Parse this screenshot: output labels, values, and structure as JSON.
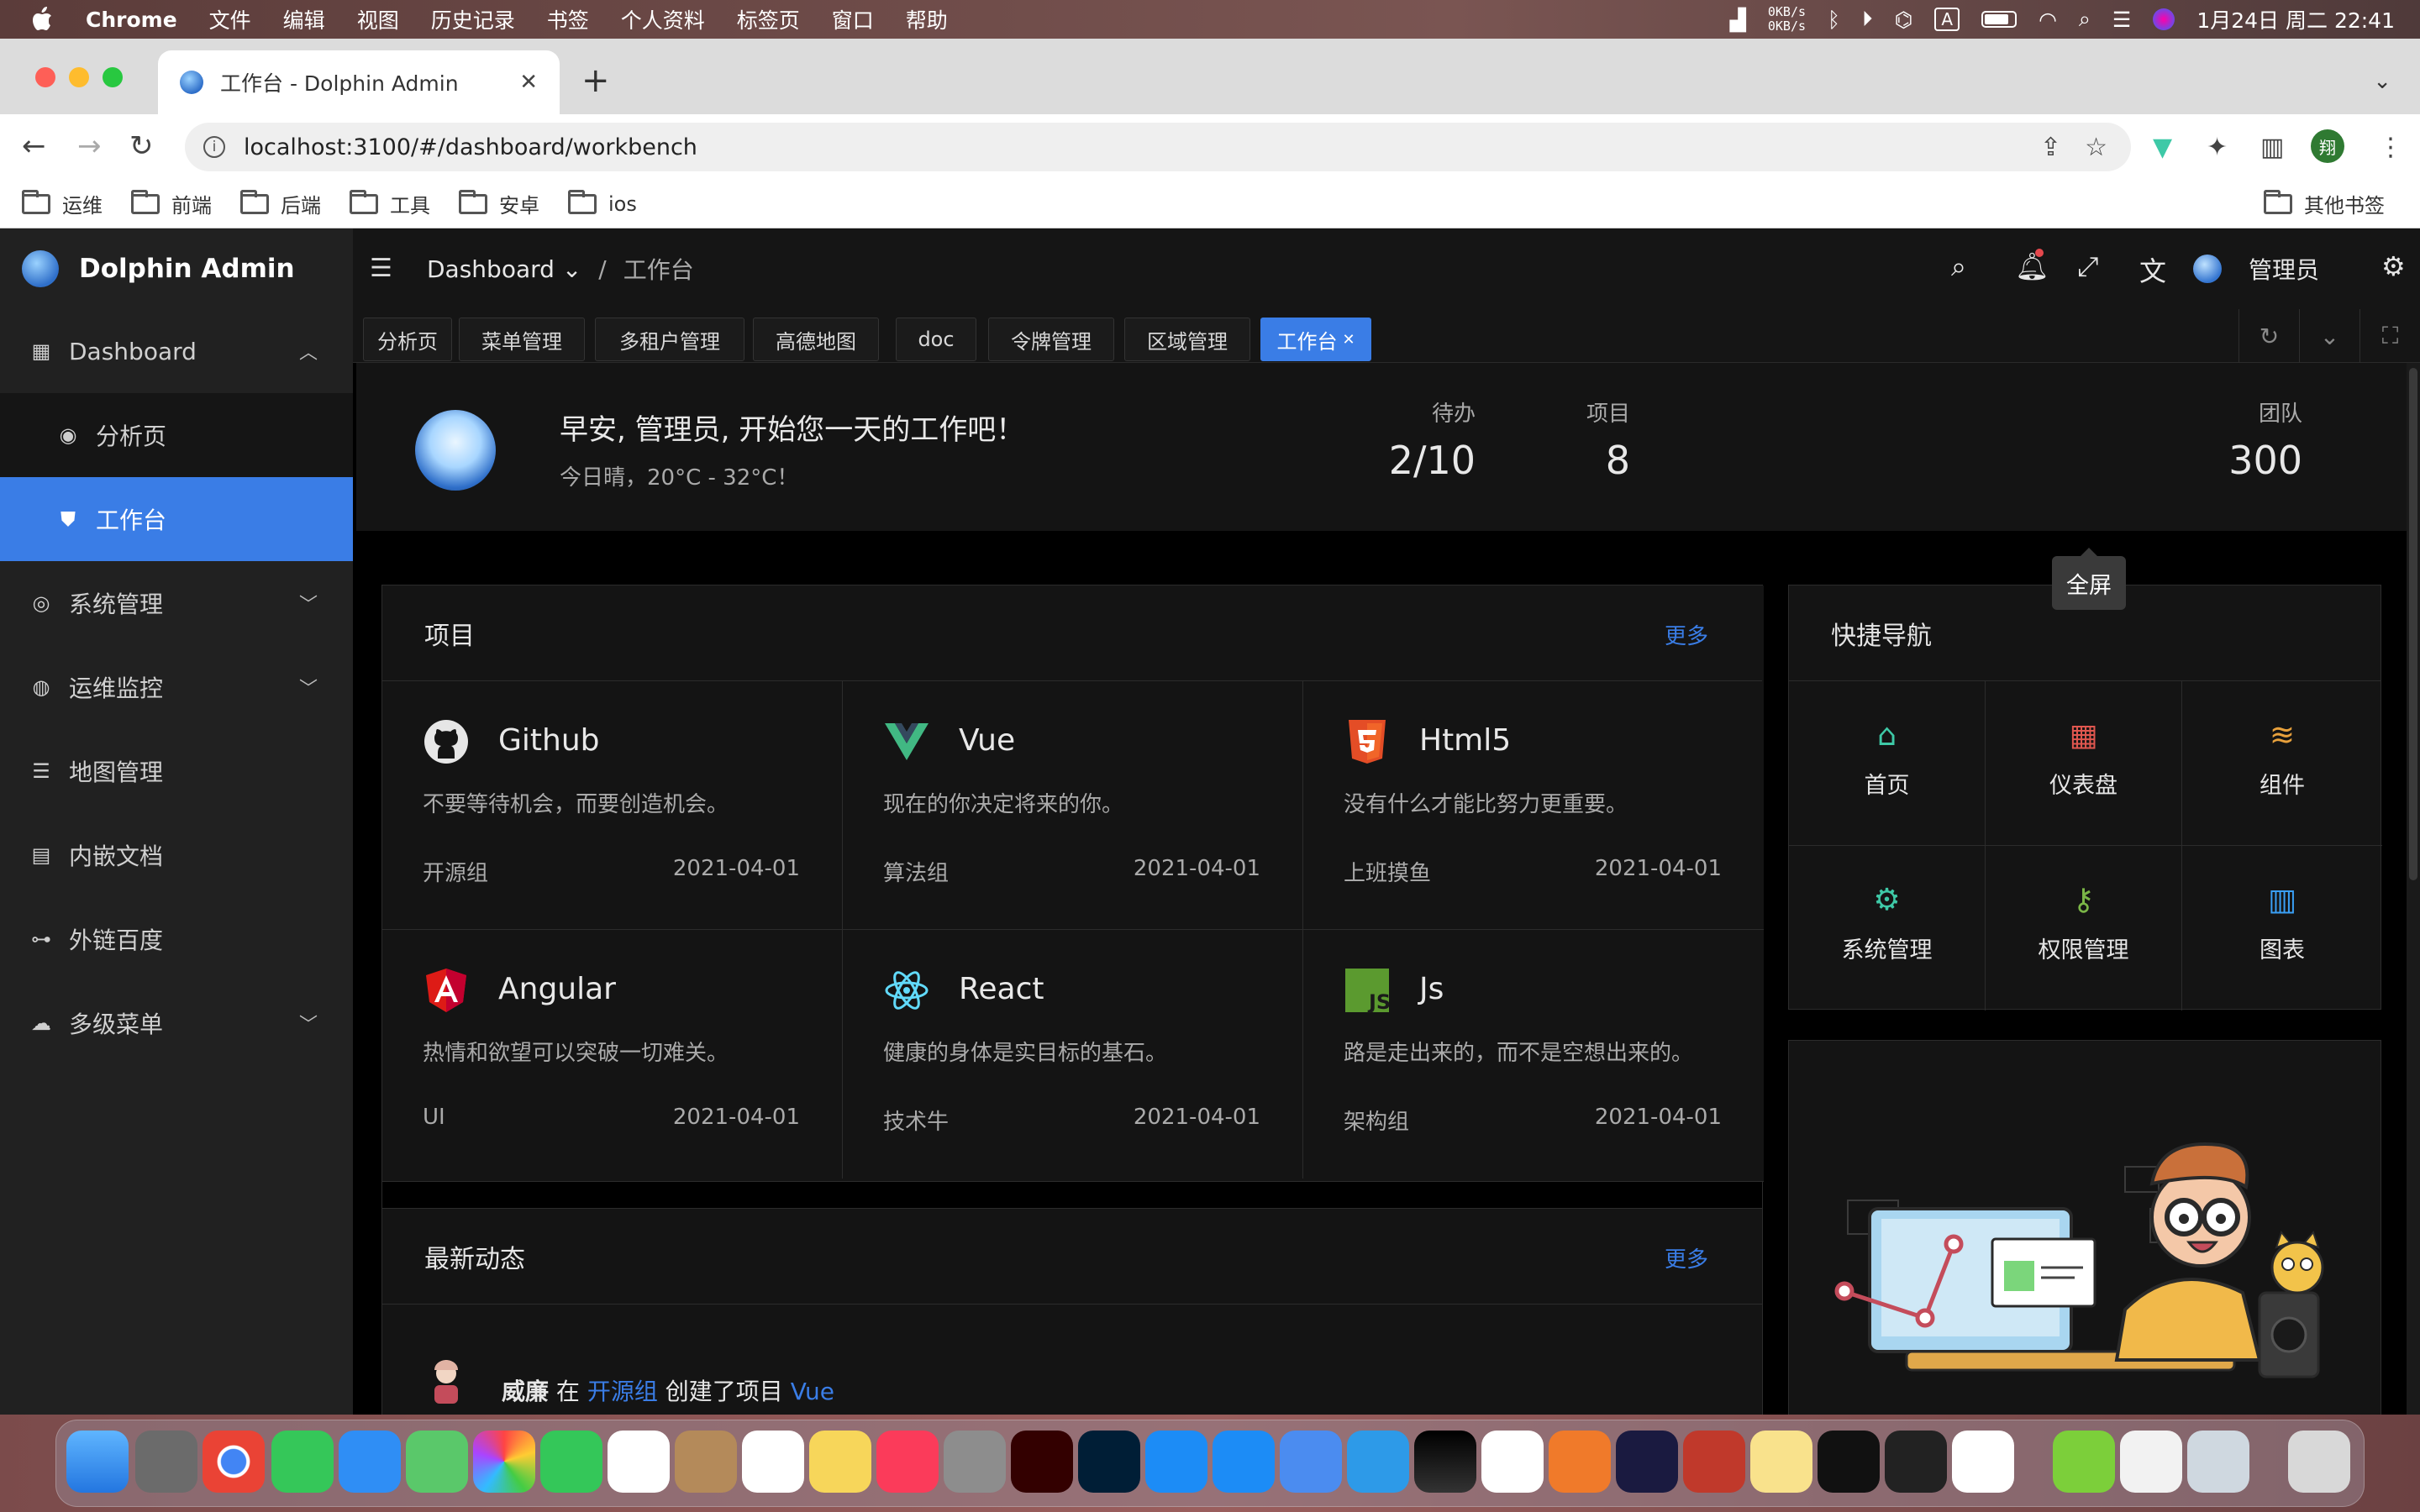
{
  "macos": {
    "menubar": [
      "Chrome",
      "文件",
      "编辑",
      "视图",
      "历史记录",
      "书签",
      "个人资料",
      "标签页",
      "窗口",
      "帮助"
    ],
    "netspeed_up": "0KB/s",
    "netspeed_down": "0KB/s",
    "date_time": "1月24日 周二  22:41"
  },
  "browser": {
    "tab_title": "工作台 - Dolphin Admin",
    "url": "localhost:3100/#/dashboard/workbench",
    "profile_initial": "翔",
    "bookmarks": [
      "运维",
      "前端",
      "后端",
      "工具",
      "安卓",
      "ios"
    ],
    "other_bookmarks": "其他书签"
  },
  "app": {
    "name": "Dolphin Admin",
    "sidebar": [
      {
        "label": "Dashboard",
        "icon": "dashboard-icon"
      },
      {
        "label": "分析页",
        "icon": "analysis-icon"
      },
      {
        "label": "工作台",
        "icon": "workbench-icon"
      },
      {
        "label": "系统管理",
        "icon": "chrome-icon"
      },
      {
        "label": "运维监控",
        "icon": "github-icon"
      },
      {
        "label": "地图管理",
        "icon": "list-icon"
      },
      {
        "label": "内嵌文档",
        "icon": "doc-icon"
      },
      {
        "label": "外链百度",
        "icon": "link-icon"
      },
      {
        "label": "多级菜单",
        "icon": "cloud-icon"
      }
    ],
    "breadcrumb": {
      "parent": "Dashboard",
      "current": "工作台"
    },
    "user": "管理员",
    "tooltip": "全屏",
    "tabs": [
      "分析页",
      "菜单管理",
      "多租户管理",
      "高德地图",
      "doc",
      "令牌管理",
      "区域管理",
      "工作台"
    ],
    "greeting": "早安, 管理员, 开始您一天的工作吧！",
    "weather": "今日晴，20°C - 32°C！",
    "stats": [
      {
        "label": "待办",
        "value": "2/10"
      },
      {
        "label": "项目",
        "value": "8"
      },
      {
        "label": "团队",
        "value": "300"
      }
    ],
    "projects_title": "项目",
    "more": "更多",
    "projects": [
      {
        "name": "Github",
        "desc": "不要等待机会，而要创造机会。",
        "group": "开源组",
        "date": "2021-04-01"
      },
      {
        "name": "Vue",
        "desc": "现在的你决定将来的你。",
        "group": "算法组",
        "date": "2021-04-01"
      },
      {
        "name": "Html5",
        "desc": "没有什么才能比努力更重要。",
        "group": "上班摸鱼",
        "date": "2021-04-01"
      },
      {
        "name": "Angular",
        "desc": "热情和欲望可以突破一切难关。",
        "group": "UI",
        "date": "2021-04-01"
      },
      {
        "name": "React",
        "desc": "健康的身体是实目标的基石。",
        "group": "技术牛",
        "date": "2021-04-01"
      },
      {
        "name": "Js",
        "desc": "路是走出来的，而不是空想出来的。",
        "group": "架构组",
        "date": "2021-04-01"
      }
    ],
    "quicknav_title": "快捷导航",
    "quicknav": [
      {
        "label": "首页",
        "color": "#3ec9a7"
      },
      {
        "label": "仪表盘",
        "color": "#e0574f"
      },
      {
        "label": "组件",
        "color": "#e8a13c"
      },
      {
        "label": "系统管理",
        "color": "#3ec9a7"
      },
      {
        "label": "权限管理",
        "color": "#7ab547"
      },
      {
        "label": "图表",
        "color": "#3a9ff5"
      }
    ],
    "activity_title": "最新动态",
    "activity": {
      "user": "威廉",
      "verb1": "在",
      "group": "开源组",
      "verb2": "创建了项目",
      "project": "Vue"
    }
  }
}
